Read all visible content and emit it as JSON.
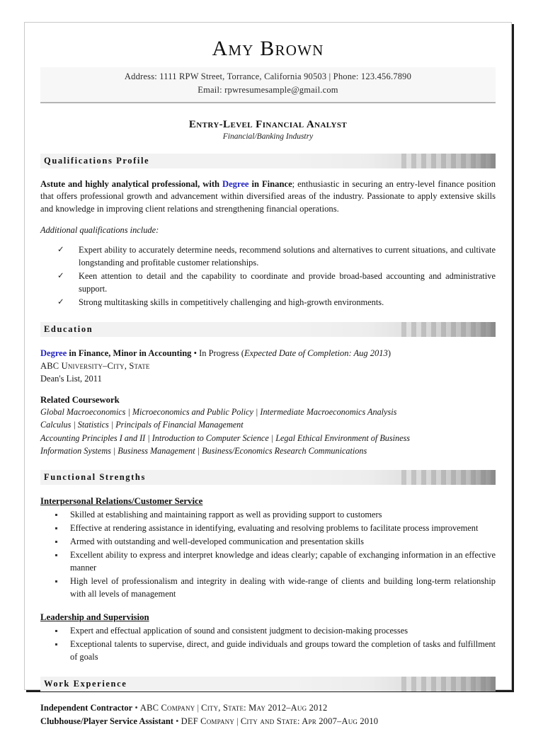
{
  "document": {
    "type": "resume"
  },
  "header": {
    "name": "Amy Brown",
    "contact_line_1": "Address: 1111 RPW Street, Torrance, California 90503  |  Phone: 123.456.7890",
    "contact_line_2": "Email: rpwresumesample@gmail.com",
    "target_title": "Entry-Level Financial Analyst",
    "target_subtitle": "Financial/Banking Industry"
  },
  "colors": {
    "link_blue": "#2222c4",
    "sheet_border": "#c8c8c8",
    "bar_light": "#f2f2f2",
    "bar_dark": "#8f8f8f"
  },
  "sections": {
    "qualifications": {
      "title": "Qualifications Profile",
      "paragraph": {
        "lead_bold_1": "Astute and highly analytical professional, with ",
        "lead_blue": "Degree",
        "lead_bold_2": " in Finance",
        "rest": "; enthusiastic in securing an entry-level finance position that offers professional growth and advancement within diversified areas of the industry. Passionate to apply extensive skills and knowledge in improving client relations and strengthening financial operations."
      },
      "additional_label": "Additional qualifications include:",
      "bullets": [
        "Expert ability to accurately determine needs, recommend solutions and alternatives to current situations, and cultivate longstanding and profitable customer relationships.",
        "Keen attention to detail and the capability to coordinate and provide broad-based accounting and administrative support.",
        "Strong multitasking skills in competitively challenging and high-growth environments."
      ]
    },
    "education": {
      "title": "Education",
      "degree_blue": "Degree",
      "degree_bold": " in Finance, Minor in Accounting",
      "degree_sep": " • In Progress (",
      "degree_italic": "Expected Date of Completion: Aug 2013",
      "degree_close": ")",
      "school": "ABC University–City, State",
      "honors": "Dean's List, 2011",
      "coursework_heading": "Related Coursework",
      "coursework_lines": [
        "Global Macroeconomics  |  Microeconomics and Public Policy  |  Intermediate Macroeconomics Analysis",
        "Calculus  |  Statistics  |  Principals of Financial Management",
        "Accounting Principles I and II  |  Introduction to Computer Science  |  Legal Ethical Environment of Business",
        "Information Systems  |  Business Management  |  Business/Economics Research Communications"
      ]
    },
    "functional_strengths": {
      "title": "Functional Strengths",
      "groups": [
        {
          "heading": "Interpersonal Relations/Customer Service ",
          "bullets": [
            "Skilled at establishing and maintaining rapport as well as providing support to customers",
            "Effective at rendering assistance in identifying, evaluating and resolving problems to facilitate process improvement",
            "Armed with outstanding and well-developed communication and presentation skills",
            "Excellent ability to express and interpret knowledge and ideas clearly; capable of exchanging information in an effective manner",
            "High level of professionalism and integrity in dealing with wide-range of clients and building long-term relationship with all levels of management"
          ]
        },
        {
          "heading": "Leadership and Supervision",
          "bullets": [
            "Expert and effectual application of sound and consistent judgment to decision-making processes",
            "Exceptional talents to supervise, direct, and guide individuals and groups toward the completion of tasks and fulfillment of goals"
          ]
        }
      ]
    },
    "work_experience": {
      "title": "Work Experience",
      "entries": [
        {
          "role": "Independent Contractor",
          "separator": " • ",
          "company": "ABC Company",
          "pipe": "  |  ",
          "location_dates": "City, State: May 2012–Aug 2012"
        },
        {
          "role": "Clubhouse/Player Service Assistant",
          "separator": " • ",
          "company": "DEF Company",
          "pipe": "  |  ",
          "location_dates": "City and State: Apr 2007–Aug 2010"
        }
      ]
    }
  }
}
